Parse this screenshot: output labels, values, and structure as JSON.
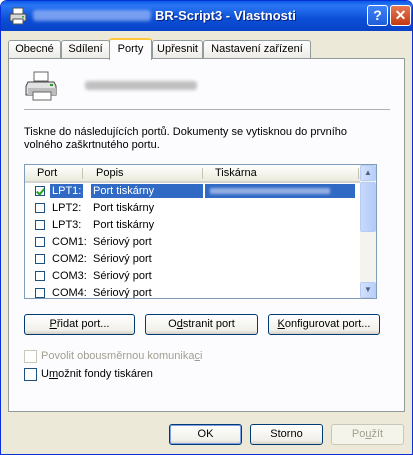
{
  "window": {
    "title": "BR-Script3 - Vlastnosti",
    "help_glyph": "?",
    "close_glyph": "✕"
  },
  "tabs": [
    {
      "label": "Obecné"
    },
    {
      "label": "Sdílení"
    },
    {
      "label": "Porty",
      "active": true
    },
    {
      "label": "Upřesnit"
    },
    {
      "label": "Nastavení zařízení"
    }
  ],
  "ports_page": {
    "description": "Tiskne do následujících portů. Dokumenty se vytisknou do prvního volného zaškrtnutého portu.",
    "columns": {
      "port": "Port",
      "desc": "Popis",
      "printer": "Tiskárna"
    },
    "rows": [
      {
        "port": "LPT1:",
        "desc": "Port tiskárny",
        "checked": true,
        "selected": true
      },
      {
        "port": "LPT2:",
        "desc": "Port tiskárny",
        "checked": false
      },
      {
        "port": "LPT3:",
        "desc": "Port tiskárny",
        "checked": false
      },
      {
        "port": "COM1:",
        "desc": "Sériový port",
        "checked": false
      },
      {
        "port": "COM2:",
        "desc": "Sériový port",
        "checked": false
      },
      {
        "port": "COM3:",
        "desc": "Sériový port",
        "checked": false
      },
      {
        "port": "COM4:",
        "desc": "Sériový port",
        "checked": false
      }
    ],
    "buttons": {
      "add": {
        "pre": "",
        "key": "P",
        "post": "řidat port..."
      },
      "remove": {
        "pre": "O",
        "key": "d",
        "post": "stranit port"
      },
      "configure": {
        "pre": "",
        "key": "K",
        "post": "onfigurovat port..."
      }
    },
    "options": {
      "bidi": {
        "pre": "Povolit obousměrnou komunika",
        "key": "c",
        "post": "i",
        "checked": false,
        "enabled": false
      },
      "pooling": {
        "pre": "U",
        "key": "m",
        "post": "ožnit fondy tiskáren",
        "checked": false,
        "enabled": true
      }
    }
  },
  "footer": {
    "ok": "OK",
    "cancel": "Storno",
    "apply": {
      "pre": "Po",
      "key": "u",
      "post": "žít"
    }
  },
  "colors": {
    "selection": "#316ac5",
    "titlebar": "#0b4fd6",
    "dialog_bg": "#ece9d8"
  }
}
